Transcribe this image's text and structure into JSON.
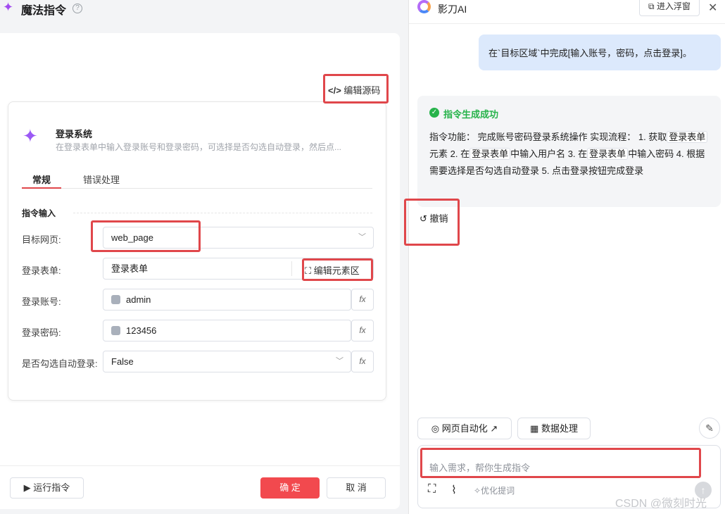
{
  "left": {
    "title": "魔法指令",
    "help_icon": "question-icon",
    "edit_source_label": "编辑源码",
    "system": {
      "title": "登录系统",
      "description": "在登录表单中输入登录账号和登录密码，可选择是否勾选自动登录，然后点..."
    },
    "tabs": [
      {
        "label": "常规",
        "active": true
      },
      {
        "label": "错误处理",
        "active": false
      }
    ],
    "section_title": "指令输入",
    "fields": [
      {
        "label": "目标网页:",
        "value": "web_page",
        "type": "select"
      },
      {
        "label": "登录表单:",
        "value": "登录表单",
        "action": "编辑元素区",
        "type": "element"
      },
      {
        "label": "登录账号:",
        "value": "admin",
        "type": "python"
      },
      {
        "label": "登录密码:",
        "value": "123456",
        "type": "python"
      },
      {
        "label": "是否勾选自动登录:",
        "value": "False",
        "type": "select"
      }
    ],
    "fx_label": "fx",
    "footer": {
      "run": "运行指令",
      "ok": "确 定",
      "cancel": "取 消"
    }
  },
  "right": {
    "app_name": "影刀AI",
    "float_button": "进入浮窗",
    "close": "✕",
    "user_message": "在`目标区域`中完成[输入账号，密码，点击登录]。",
    "reply": {
      "status": "指令生成成功",
      "seg1": "指令功能： 完成账号密码登录系统操作 实现流程： 1. 获取",
      "code1": "登录表单",
      "seg2": "元素 2. 在",
      "code2": "登录表单",
      "seg3": "中输入用户名 3. 在",
      "code3": "登录表单",
      "seg4": "中输入密码 4. 根据需要选择是否勾选自动登录 5. 点击登录按钮完成登录"
    },
    "undo": "撤销",
    "chips": [
      {
        "label": "网页自动化",
        "icon": "chrome-icon"
      },
      {
        "label": "数据处理",
        "icon": "table-icon"
      }
    ],
    "input_placeholder": "输入需求，帮你生成指令",
    "optimize": "优化提词"
  },
  "watermark": "CSDN @微刻时光",
  "colors": {
    "accent": "#f2494e",
    "success": "#27b34b",
    "highlight": "#e0474b",
    "bubble": "#dce9fc"
  }
}
